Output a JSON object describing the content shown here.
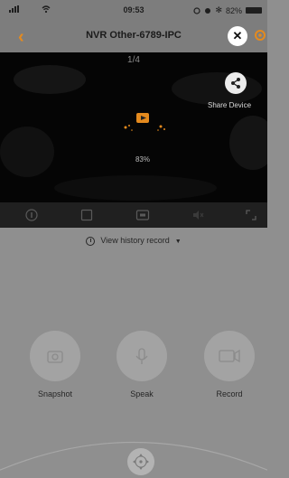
{
  "status_bar": {
    "time": "09:53",
    "battery_text": "82%"
  },
  "header": {
    "title": "NVR Other-6789-IPC"
  },
  "video": {
    "page_indicator": "1/4",
    "share_label": "Share Device",
    "loading_percent": "83%"
  },
  "controls": [
    "info-icon",
    "fullscreen-square-icon",
    "definition-icon",
    "mute-icon",
    "expand-icon"
  ],
  "history": {
    "label": "View history record"
  },
  "actions": [
    {
      "label": "Snapshot"
    },
    {
      "label": "Speak"
    },
    {
      "label": "Record"
    }
  ],
  "colors": {
    "accent": "#e48a1e",
    "video_bg": "#050505",
    "overlay": "#8f8f8f"
  }
}
